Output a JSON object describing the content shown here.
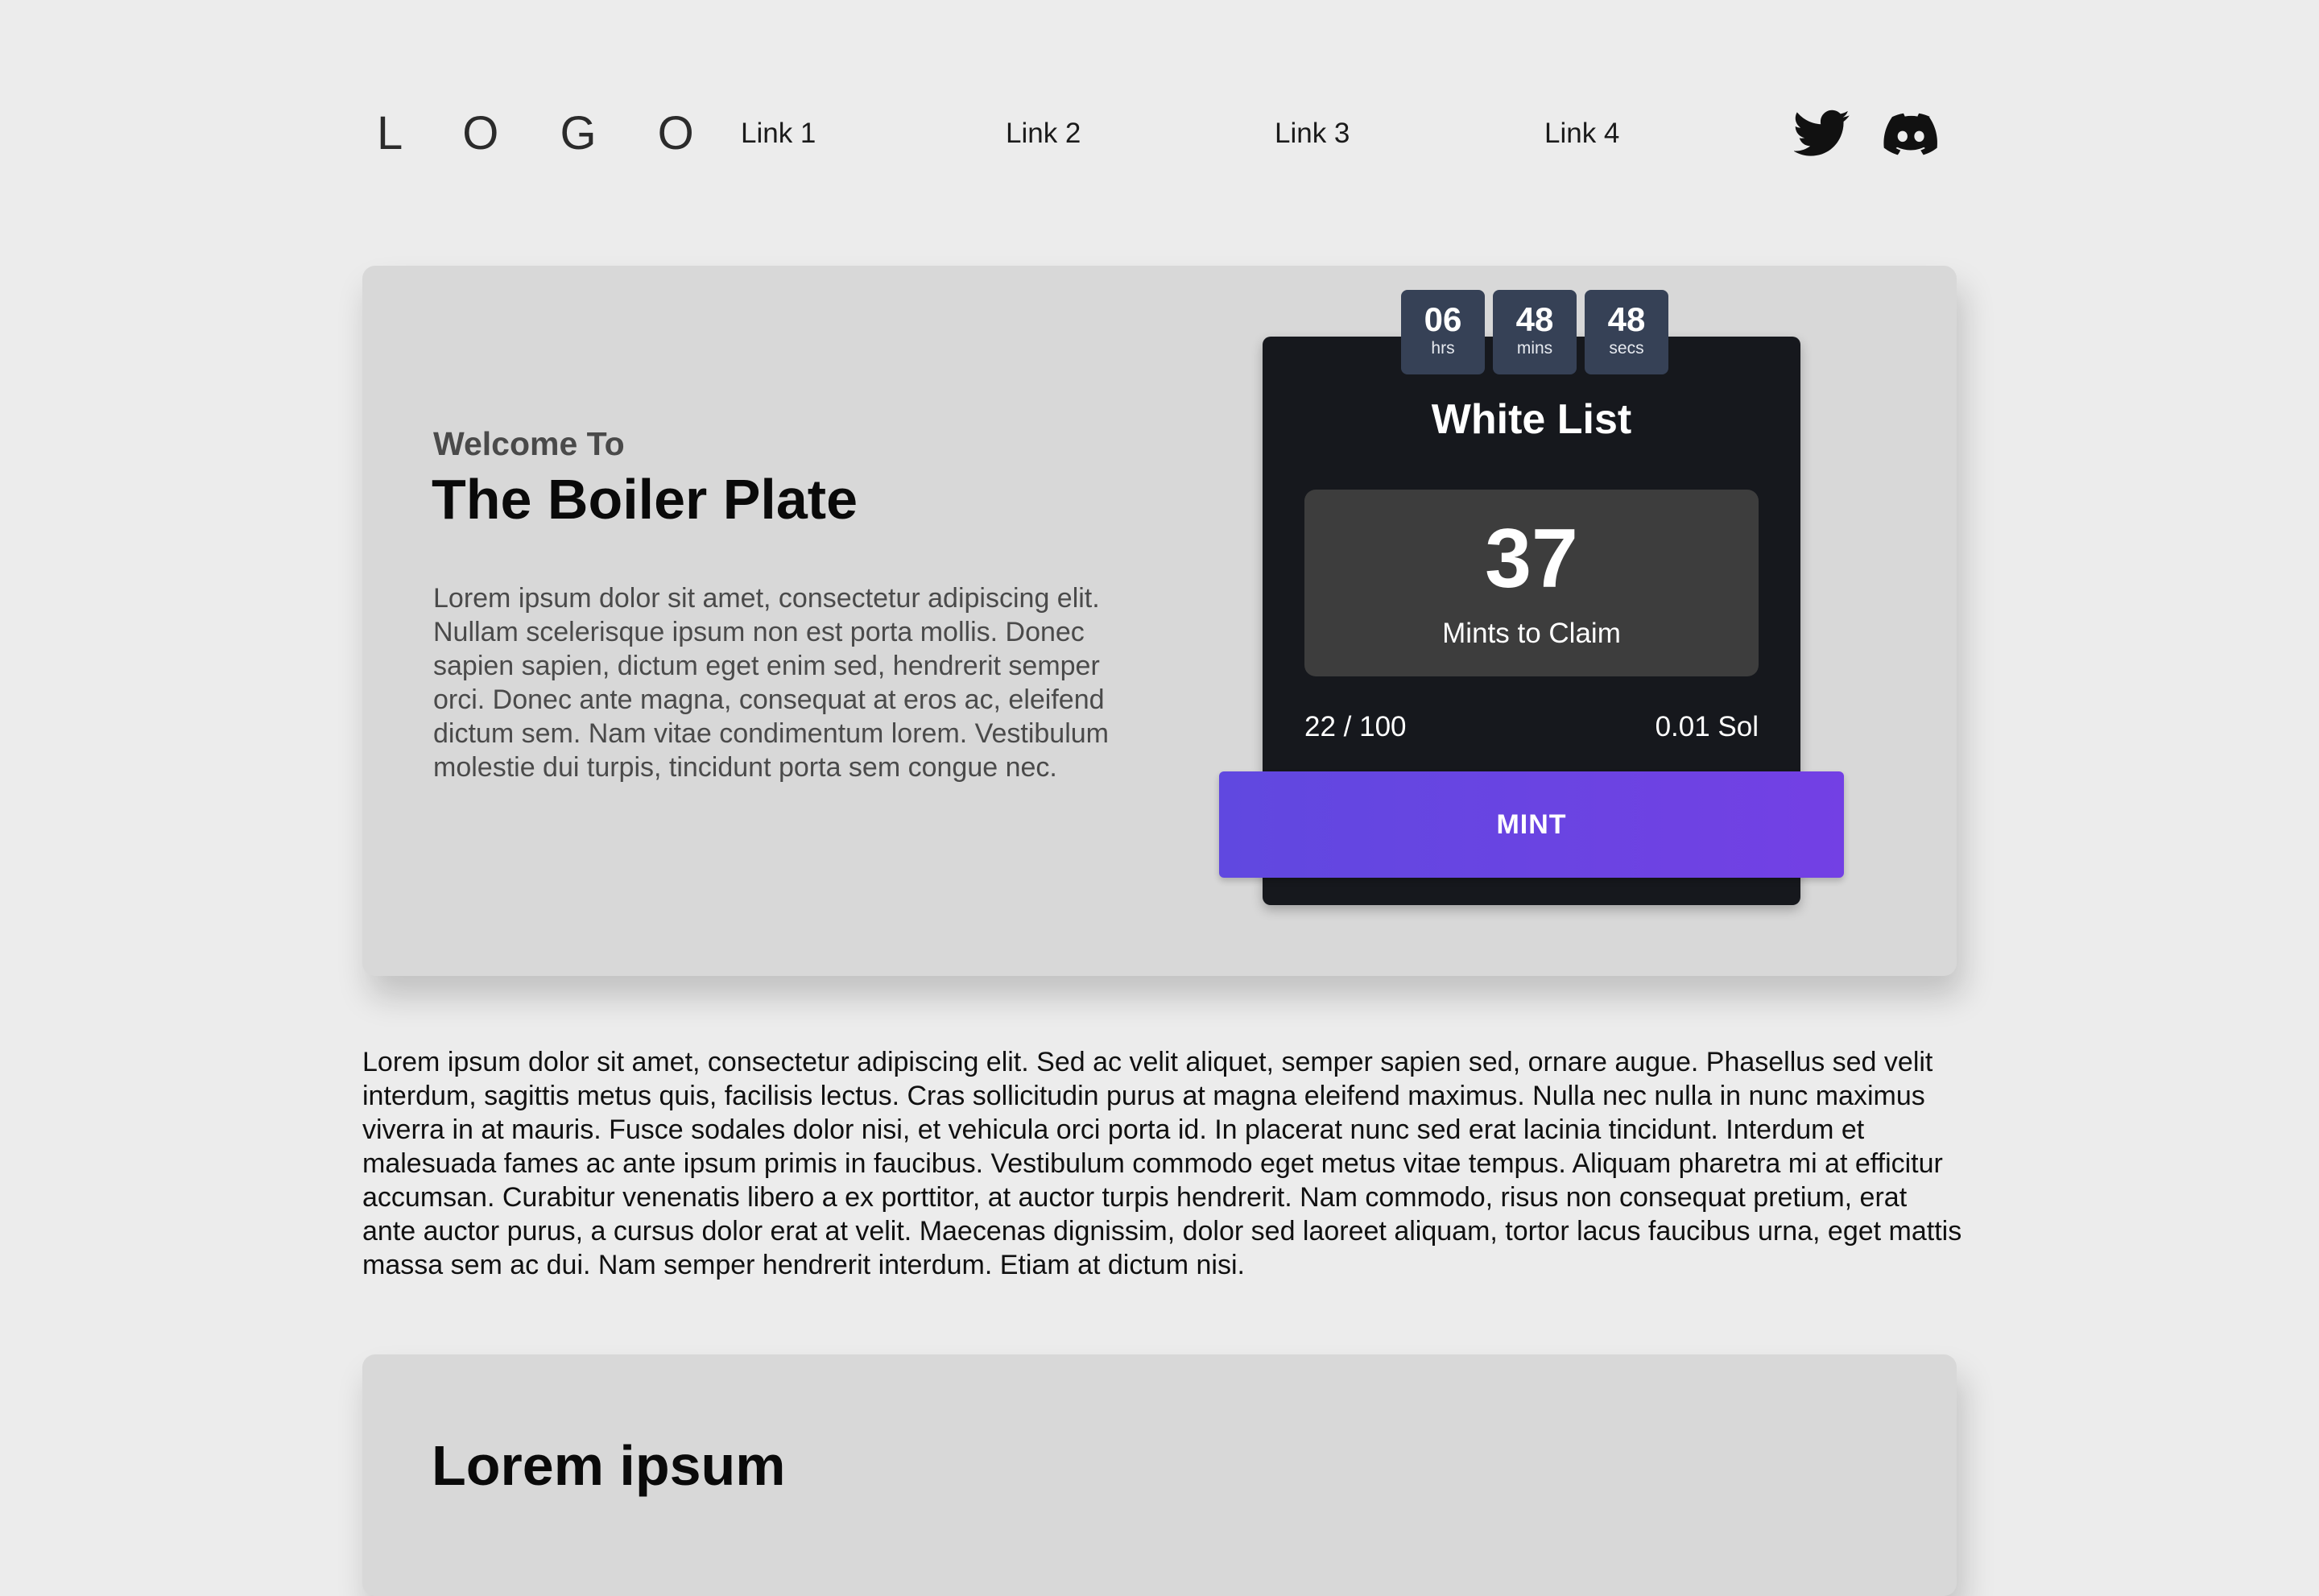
{
  "header": {
    "logo": "L O G O",
    "nav": [
      "Link 1",
      "Link 2",
      "Link 3",
      "Link 4"
    ],
    "social": [
      "twitter-icon",
      "discord-icon"
    ]
  },
  "hero": {
    "welcome": "Welcome To",
    "title": "The Boiler Plate",
    "description": "Lorem ipsum dolor sit amet, consectetur adipiscing elit. Nullam scelerisque ipsum non est porta mollis. Donec sapien sapien, dictum eget enim sed, hendrerit semper orci. Donec ante magna, consequat at eros ac, eleifend dictum sem. Nam vitae condimentum lorem. Vestibulum molestie dui turpis, tincidunt porta sem congue nec."
  },
  "mint": {
    "countdown": [
      {
        "value": "06",
        "unit": "hrs"
      },
      {
        "value": "48",
        "unit": "mins"
      },
      {
        "value": "48",
        "unit": "secs"
      }
    ],
    "title": "White List",
    "claim_count": "37",
    "claim_label": "Mints to Claim",
    "supply": "22 / 100",
    "price": "0.01 Sol",
    "button_label": "MINT"
  },
  "body_text": "Lorem ipsum dolor sit amet, consectetur adipiscing elit. Sed ac velit aliquet, semper sapien sed, ornare augue. Phasellus sed velit interdum, sagittis metus quis, facilisis lectus. Cras sollicitudin purus at magna eleifend maximus. Nulla nec nulla in nunc maximus viverra in at mauris. Fusce sodales dolor nisi, et vehicula orci porta id. In placerat nunc sed erat lacinia tincidunt. Interdum et malesuada fames ac ante ipsum primis in faucibus. Vestibulum commodo eget metus vitae tempus. Aliquam pharetra mi at efficitur accumsan. Curabitur venenatis libero a ex porttitor, at auctor turpis hendrerit. Nam commodo, risus non consequat pretium, erat ante auctor purus, a cursus dolor erat at velit. Maecenas dignissim, dolor sed laoreet aliquam, tortor lacus faucibus urna, eget mattis massa sem ac dui. Nam semper hendrerit interdum. Etiam at dictum nisi.",
  "lower_card": {
    "heading": "Lorem ipsum"
  },
  "colors": {
    "page_bg": "#ececec",
    "card_bg": "#d8d8d8",
    "panel_bg": "#16181d",
    "countdown_bg": "#364156",
    "claim_bg": "#3d3d3d",
    "button_start": "#6048e0",
    "button_end": "#7340e4"
  }
}
